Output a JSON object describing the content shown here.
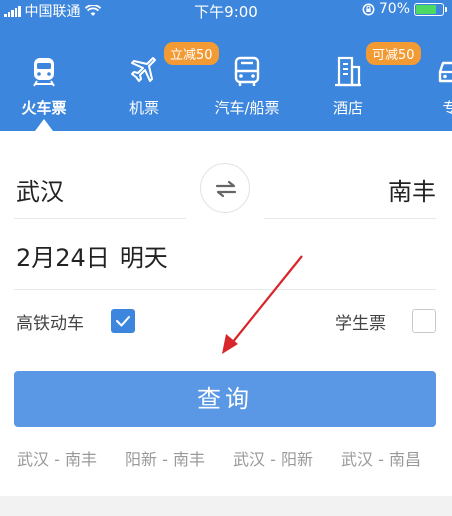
{
  "status_bar": {
    "carrier": "中国联通",
    "time": "下午9:00",
    "battery": "70%",
    "battery_level": 0.7
  },
  "tabs": [
    {
      "label": "火车票",
      "icon": "train-icon",
      "active": true,
      "badge": ""
    },
    {
      "label": "机票",
      "icon": "airplane-icon",
      "active": false,
      "badge": "立减50"
    },
    {
      "label": "汽车/船票",
      "icon": "bus-icon",
      "active": false,
      "badge": ""
    },
    {
      "label": "酒店",
      "icon": "hotel-icon",
      "active": false,
      "badge": "可减50"
    },
    {
      "label": "专",
      "icon": "car-icon",
      "active": false,
      "badge": ""
    }
  ],
  "form": {
    "from_station": "武汉",
    "to_station": "南丰",
    "date": "2月24日",
    "day": "明天",
    "high_speed_label": "高铁动车",
    "high_speed_checked": true,
    "student_label": "学生票",
    "student_checked": false,
    "search_label": "查询"
  },
  "history": [
    "武汉 - 南丰",
    "阳新 - 南丰",
    "武汉 - 阳新",
    "武汉 - 南昌"
  ],
  "colors": {
    "primary": "#3d86dd",
    "button": "#5a98e5",
    "badge": "#f29a34",
    "annotation_arrow": "#d7262c"
  }
}
